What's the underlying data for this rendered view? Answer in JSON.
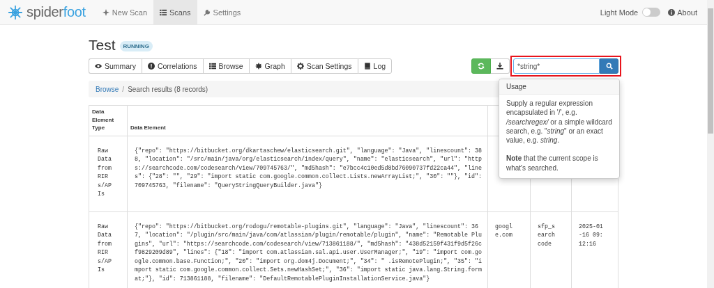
{
  "navbar": {
    "logo": {
      "part_1": "spider",
      "part_2": "foot"
    },
    "items": [
      {
        "label": "New Scan",
        "kind": "new",
        "selected": false
      },
      {
        "label": "Scans",
        "kind": "list",
        "selected": true
      },
      {
        "label": "Settings",
        "kind": "wrench",
        "selected": false
      }
    ],
    "light_mode": {
      "label": "Light Mode",
      "on": false
    },
    "about": "About"
  },
  "scan": {
    "title": "Test",
    "status": "RUNNING"
  },
  "tabs": [
    {
      "label": "Summary",
      "kind": "eye"
    },
    {
      "label": "Correlations",
      "kind": "alert"
    },
    {
      "label": "Browse",
      "kind": "list"
    },
    {
      "label": "Graph",
      "kind": "burst"
    },
    {
      "label": "Scan Settings",
      "kind": "gear"
    },
    {
      "label": "Log",
      "kind": "book"
    }
  ],
  "search": {
    "value": "*string*"
  },
  "breadcrumb": {
    "link": "Browse",
    "separator": "/",
    "current": "Search results (8 records)"
  },
  "table": {
    "columns": [
      "Data Element Type",
      "Data Element"
    ],
    "rows": [
      {
        "type": "Raw Data from RIRs/APIs",
        "element": "{\"repo\": \"https://bitbucket.org/dkartaschew/elasticsearch.git\", \"language\": \"Java\", \"linescount\": 388, \"location\": \"/src/main/java/org/elasticsearch/index/query\", \"name\": \"elasticsearch\", \"url\": \"https://searchcode.com/codesearch/view/709745763/\", \"md5hash\": \"e7bcc4c10ed5d8bd76090737fd22ca44\", \"lines\": {\"28\": \"\", \"29\": \"import static com.google.common.collect.Lists.newArrayList;\", \"30\": \"\"}, \"id\": 709745763, \"filename\": \"QueryStringQueryBuilder.java\"}"
      },
      {
        "type": "Raw Data from RIRs/APIs",
        "element": "{\"repo\": \"https://bitbucket.org/rodogu/remotable-plugins.git\", \"language\": \"Java\", \"linescount\": 367, \"location\": \"/plugin/src/main/java/com/atlassian/plugin/remotable/plugin\", \"name\": \"Remotable Plugins\", \"url\": \"https://searchcode.com/codesearch/view/713861188/\", \"md5hash\": \"438d52159f431f9d5f26cf9829209d89\", \"lines\": {\"18\": \"import com.atlassian.sal.api.user.UserManager;\", \"19\": \"import com.google.common.base.Function;\", \"20\": \"import org.dom4j.Document;\", \"34\": \"        .isRemotePlugin;\", \"35\": \"import static com.google.common.collect.Sets.newHashSet;\", \"36\": \"import static java.lang.String.format;\"}, \"id\": 713861188, \"filename\": \"DefaultRemotablePluginInstallationService.java\"}",
        "source": "google.com",
        "module": "sfp_searchcode",
        "date": "2025-01-16 09:12:16"
      }
    ]
  },
  "popover": {
    "title": "Usage",
    "paragraphs": [
      "Supply a regular expression encapsulated in '/', e.g. */searchregex/* or a simple wildcard search, e.g. \"*string*\" or an exact value, e.g. *string*.",
      "**Note** that the current scope is what's searched."
    ]
  }
}
